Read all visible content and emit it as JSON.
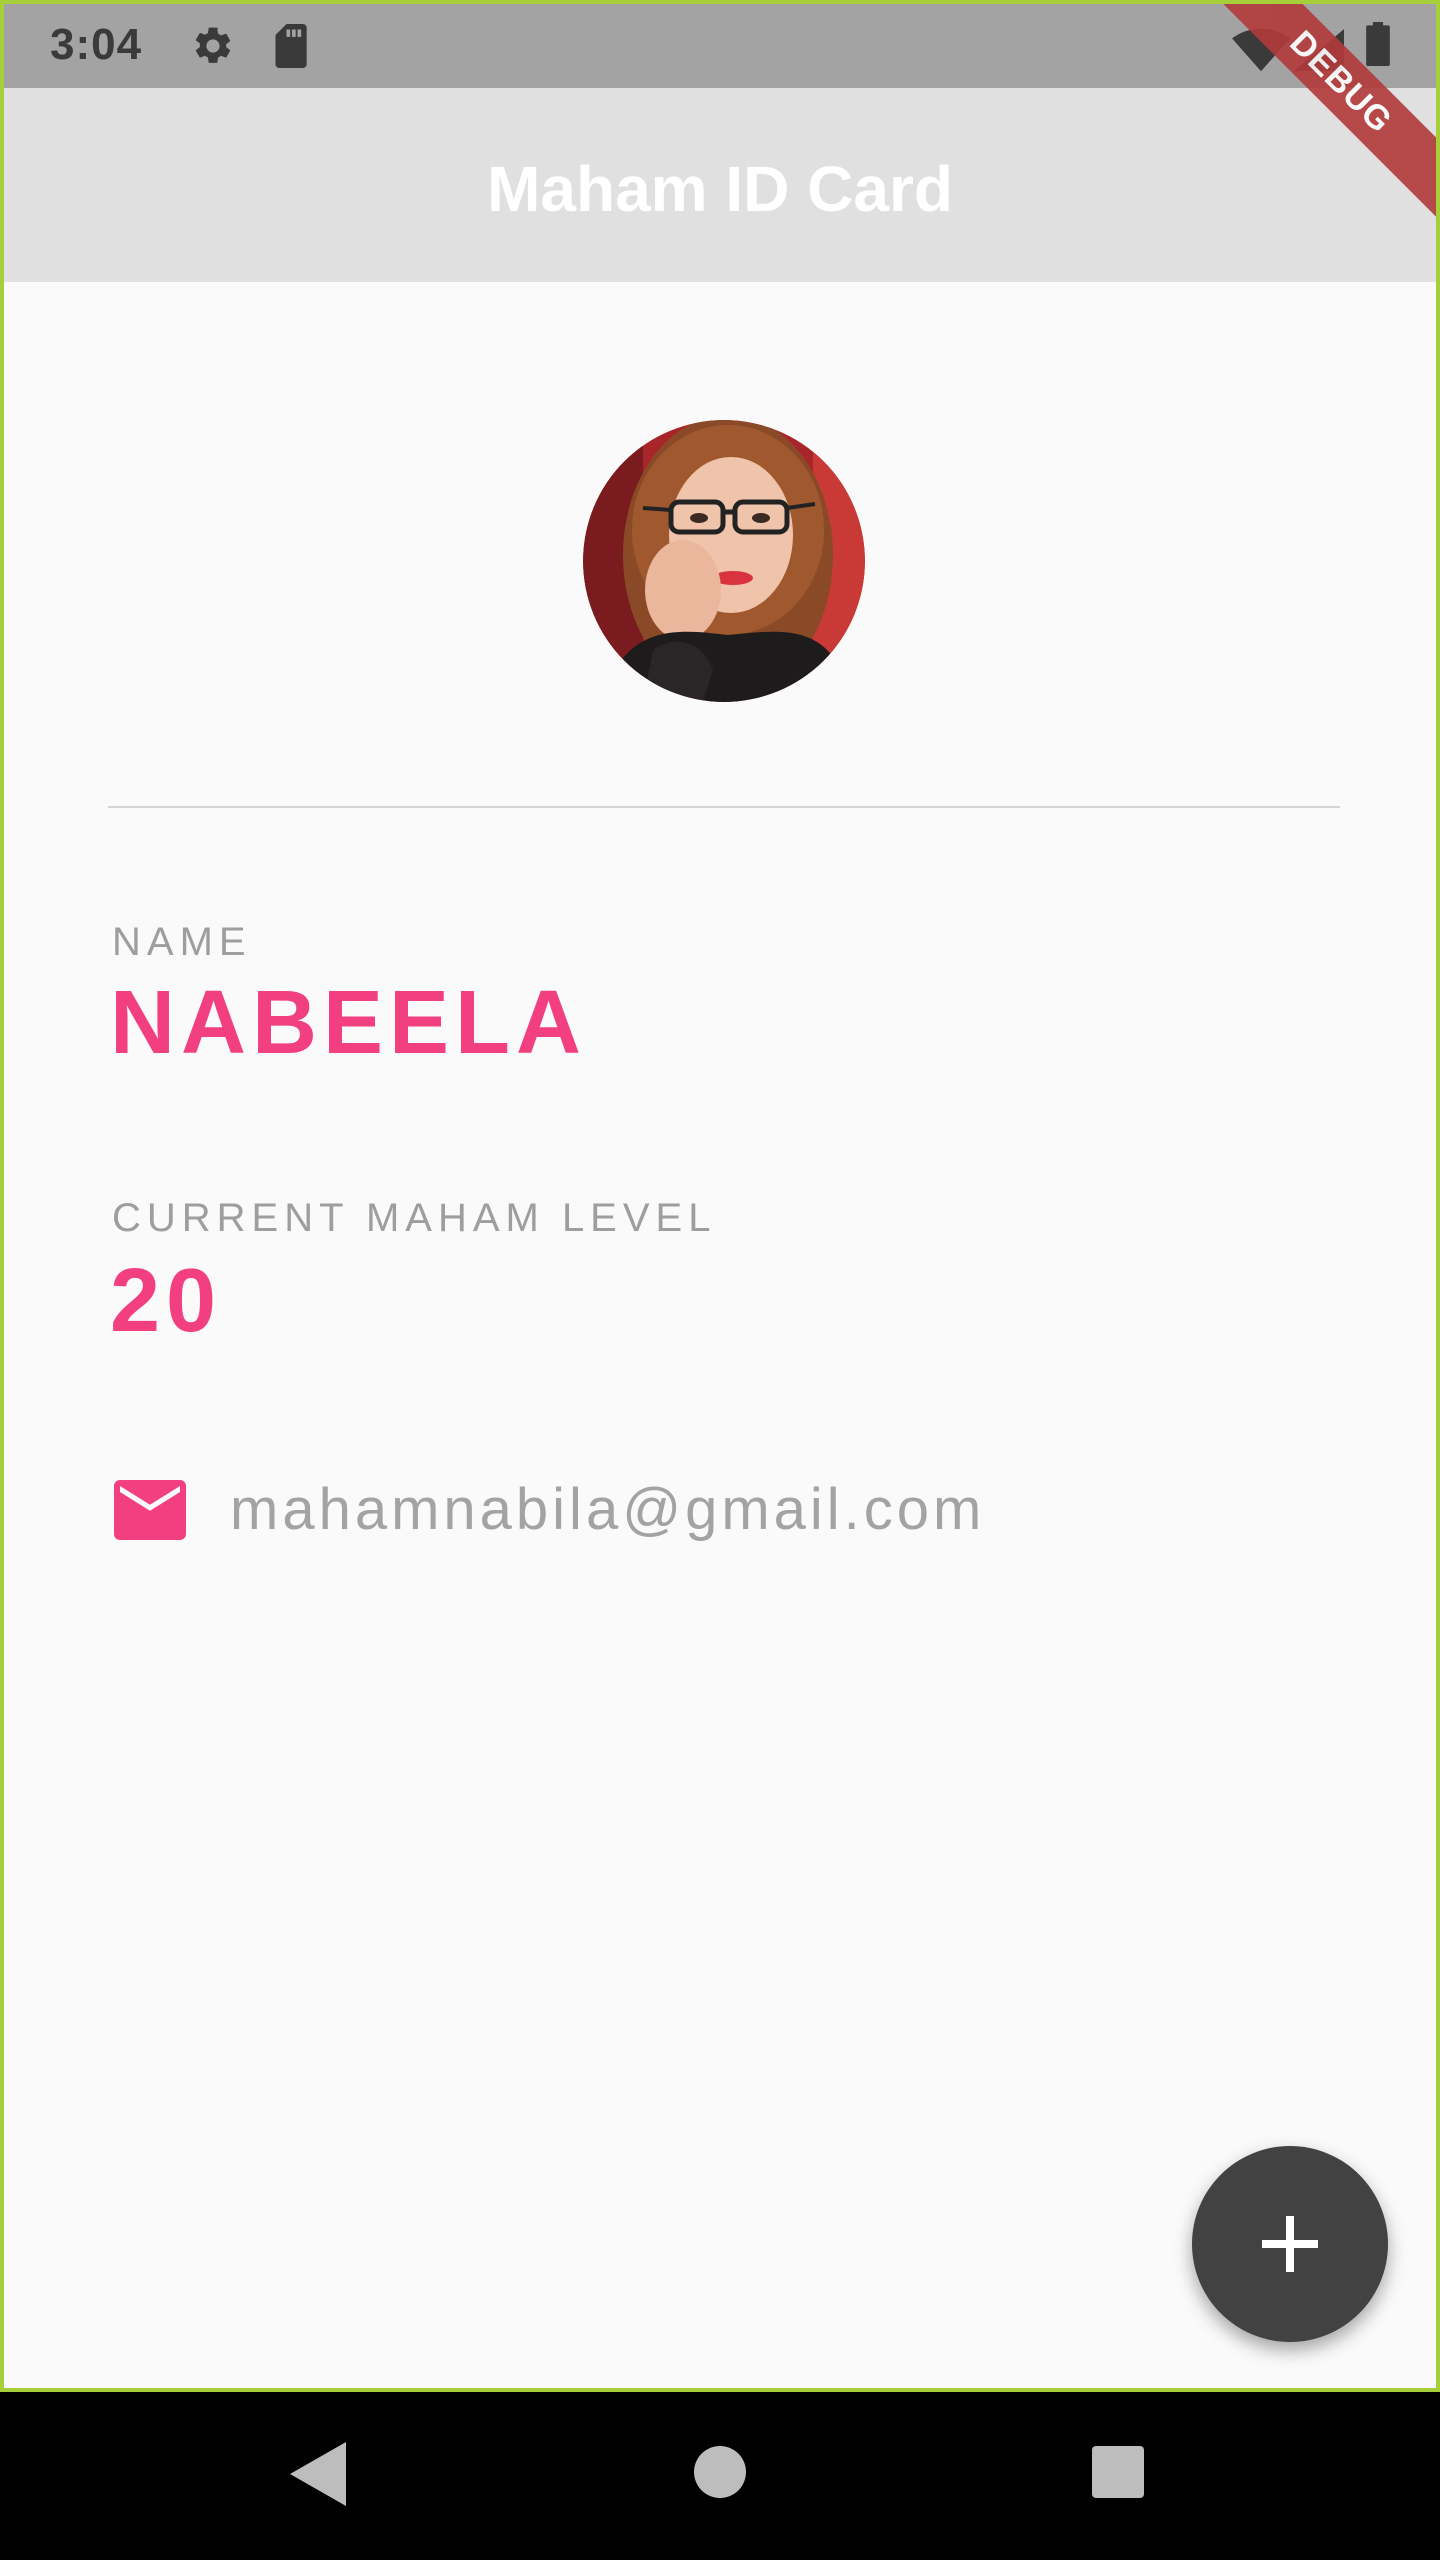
{
  "status_bar": {
    "time": "3:04",
    "icons": [
      "settings-gear-icon",
      "sd-card-icon",
      "wifi-icon",
      "cell-signal-icon",
      "battery-icon"
    ]
  },
  "debug_banner": "DEBUG",
  "app_bar": {
    "title": "Maham ID Card"
  },
  "profile": {
    "avatar": "avatar-photo",
    "name_label": "NAME",
    "name_value": "NABEELA",
    "level_label": "CURRENT MAHAM LEVEL",
    "level_value": "20",
    "email": "mahamnabila@gmail.com"
  },
  "fab": {
    "icon": "plus-icon"
  },
  "nav_bar": {
    "icons": [
      "back-icon",
      "home-icon",
      "recents-icon"
    ]
  },
  "colors": {
    "accent": "#f23f80",
    "app_bar": "#e0e0e0",
    "status_bar": "#a3a3a3",
    "fab": "#424242",
    "label": "#9e9e9e",
    "background": "#fafafa"
  }
}
